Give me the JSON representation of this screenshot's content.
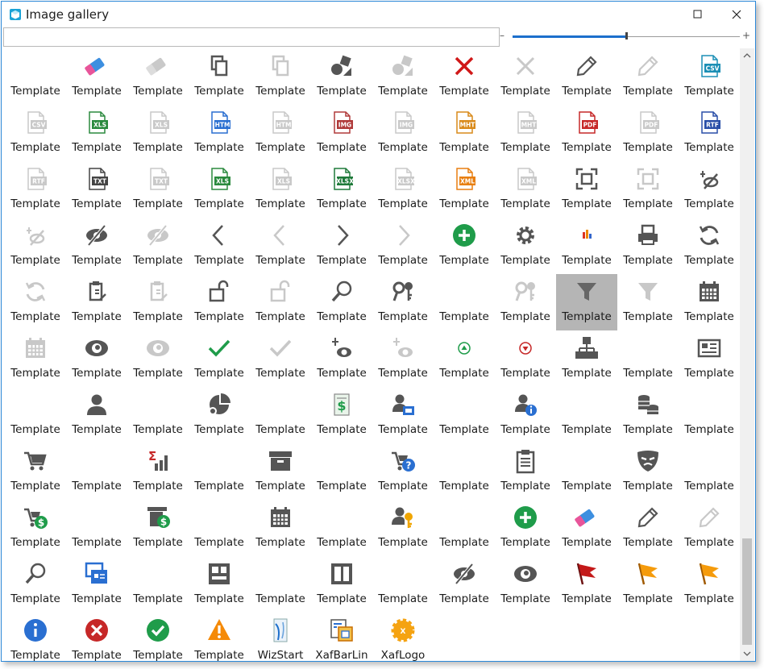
{
  "window": {
    "title": "Image gallery",
    "search": {
      "value": "",
      "placeholder": ""
    },
    "zoom": {
      "minus": "–",
      "plus": "+",
      "value": 0.5
    }
  },
  "colors": {
    "accent": "#1c6fcc",
    "selected": "#b5b5b5",
    "icon_gray": "#555555",
    "icon_disabled": "#c9c9c9"
  },
  "gallery": {
    "items": [
      {
        "label": "Template",
        "icon": "blank"
      },
      {
        "label": "Template",
        "icon": "eraser"
      },
      {
        "label": "Template",
        "icon": "eraser-disabled"
      },
      {
        "label": "Template",
        "icon": "copy"
      },
      {
        "label": "Template",
        "icon": "copy-disabled"
      },
      {
        "label": "Template",
        "icon": "shapes"
      },
      {
        "label": "Template",
        "icon": "shapes-disabled"
      },
      {
        "label": "Template",
        "icon": "delete-red-x"
      },
      {
        "label": "Template",
        "icon": "delete-x-disabled"
      },
      {
        "label": "Template",
        "icon": "pencil"
      },
      {
        "label": "Template",
        "icon": "pencil-disabled"
      },
      {
        "label": "Template",
        "icon": "csv-file"
      },
      {
        "label": "Template",
        "icon": "csv-disabled"
      },
      {
        "label": "Template",
        "icon": "xls-file"
      },
      {
        "label": "Template",
        "icon": "xls-disabled"
      },
      {
        "label": "Template",
        "icon": "htm-file"
      },
      {
        "label": "Template",
        "icon": "htm-disabled"
      },
      {
        "label": "Template",
        "icon": "img-file"
      },
      {
        "label": "Template",
        "icon": "img-disabled"
      },
      {
        "label": "Template",
        "icon": "mht-file"
      },
      {
        "label": "Template",
        "icon": "mht-disabled"
      },
      {
        "label": "Template",
        "icon": "pdf-file"
      },
      {
        "label": "Template",
        "icon": "pdf-disabled"
      },
      {
        "label": "Template",
        "icon": "rtf-file"
      },
      {
        "label": "Template",
        "icon": "rtf-disabled"
      },
      {
        "label": "Template",
        "icon": "txt-file"
      },
      {
        "label": "Template",
        "icon": "txt-disabled"
      },
      {
        "label": "Template",
        "icon": "xls-file"
      },
      {
        "label": "Template",
        "icon": "xls-disabled"
      },
      {
        "label": "Template",
        "icon": "xlsx-file"
      },
      {
        "label": "Template",
        "icon": "xlsx-disabled"
      },
      {
        "label": "Template",
        "icon": "xml-file"
      },
      {
        "label": "Template",
        "icon": "xml-disabled"
      },
      {
        "label": "Template",
        "icon": "fullscreen"
      },
      {
        "label": "Template",
        "icon": "fullscreen-disabled"
      },
      {
        "label": "Template",
        "icon": "hide-click"
      },
      {
        "label": "Template",
        "icon": "hide-click-disabled"
      },
      {
        "label": "Template",
        "icon": "eye-hidden"
      },
      {
        "label": "Template",
        "icon": "eye-hidden-disabled"
      },
      {
        "label": "Template",
        "icon": "chevron-left"
      },
      {
        "label": "Template",
        "icon": "chevron-left-disabled"
      },
      {
        "label": "Template",
        "icon": "chevron-right"
      },
      {
        "label": "Template",
        "icon": "chevron-right-disabled"
      },
      {
        "label": "Template",
        "icon": "add-green"
      },
      {
        "label": "Template",
        "icon": "gear"
      },
      {
        "label": "Template",
        "icon": "chart-small"
      },
      {
        "label": "Template",
        "icon": "printer"
      },
      {
        "label": "Template",
        "icon": "refresh"
      },
      {
        "label": "Template",
        "icon": "refresh-disabled"
      },
      {
        "label": "Template",
        "icon": "clipboard-edit"
      },
      {
        "label": "Template",
        "icon": "clipboard-edit-disabled"
      },
      {
        "label": "Template",
        "icon": "unlock"
      },
      {
        "label": "Template",
        "icon": "unlock-disabled"
      },
      {
        "label": "Template",
        "icon": "search"
      },
      {
        "label": "Template",
        "icon": "search-keys"
      },
      {
        "label": "Template",
        "icon": "blank"
      },
      {
        "label": "Template",
        "icon": "search-keys-disabled"
      },
      {
        "label": "Template",
        "icon": "filter",
        "selected": true
      },
      {
        "label": "Template",
        "icon": "filter-disabled"
      },
      {
        "label": "Template",
        "icon": "calendar"
      },
      {
        "label": "Template",
        "icon": "calendar-disabled"
      },
      {
        "label": "Template",
        "icon": "eye"
      },
      {
        "label": "Template",
        "icon": "eye-disabled"
      },
      {
        "label": "Template",
        "icon": "check"
      },
      {
        "label": "Template",
        "icon": "check-disabled"
      },
      {
        "label": "Template",
        "icon": "show-click"
      },
      {
        "label": "Template",
        "icon": "show-click-disabled"
      },
      {
        "label": "Template",
        "icon": "arrow-up-green"
      },
      {
        "label": "Template",
        "icon": "arrow-down-red"
      },
      {
        "label": "Template",
        "icon": "hierarchy"
      },
      {
        "label": "Template",
        "icon": "blank"
      },
      {
        "label": "Template",
        "icon": "business-card"
      },
      {
        "label": "Template",
        "icon": "blank"
      },
      {
        "label": "Template",
        "icon": "user"
      },
      {
        "label": "Template",
        "icon": "blank"
      },
      {
        "label": "Template",
        "icon": "pie-chart"
      },
      {
        "label": "Template",
        "icon": "blank"
      },
      {
        "label": "Template",
        "icon": "invoice"
      },
      {
        "label": "Template",
        "icon": "user-card"
      },
      {
        "label": "Template",
        "icon": "blank"
      },
      {
        "label": "Template",
        "icon": "user-info"
      },
      {
        "label": "Template",
        "icon": "blank"
      },
      {
        "label": "Template",
        "icon": "coins"
      },
      {
        "label": "Template",
        "icon": "blank"
      },
      {
        "label": "Template",
        "icon": "cart"
      },
      {
        "label": "Template",
        "icon": "blank"
      },
      {
        "label": "Template",
        "icon": "sum-chart"
      },
      {
        "label": "Template",
        "icon": "blank"
      },
      {
        "label": "Template",
        "icon": "archive"
      },
      {
        "label": "Template",
        "icon": "blank"
      },
      {
        "label": "Template",
        "icon": "cart-question"
      },
      {
        "label": "Template",
        "icon": "blank"
      },
      {
        "label": "Template",
        "icon": "clipboard"
      },
      {
        "label": "Template",
        "icon": "blank"
      },
      {
        "label": "Template",
        "icon": "mask"
      },
      {
        "label": "Template",
        "icon": "blank"
      },
      {
        "label": "Template",
        "icon": "cart-dollar"
      },
      {
        "label": "Template",
        "icon": "blank"
      },
      {
        "label": "Template",
        "icon": "cash-register"
      },
      {
        "label": "Template",
        "icon": "blank"
      },
      {
        "label": "Template",
        "icon": "calendar"
      },
      {
        "label": "Template",
        "icon": "blank"
      },
      {
        "label": "Template",
        "icon": "user-key"
      },
      {
        "label": "Template",
        "icon": "blank"
      },
      {
        "label": "Template",
        "icon": "add-green"
      },
      {
        "label": "Template",
        "icon": "eraser"
      },
      {
        "label": "Template",
        "icon": "pencil"
      },
      {
        "label": "Template",
        "icon": "pencil-disabled"
      },
      {
        "label": "Template",
        "icon": "search"
      },
      {
        "label": "Template",
        "icon": "window-card"
      },
      {
        "label": "Template",
        "icon": "blank"
      },
      {
        "label": "Template",
        "icon": "layout"
      },
      {
        "label": "Template",
        "icon": "blank"
      },
      {
        "label": "Template",
        "icon": "columns"
      },
      {
        "label": "Template",
        "icon": "blank"
      },
      {
        "label": "Template",
        "icon": "eye-hidden"
      },
      {
        "label": "Template",
        "icon": "eye"
      },
      {
        "label": "Template",
        "icon": "flag-red"
      },
      {
        "label": "Template",
        "icon": "flag-orange"
      },
      {
        "label": "Template",
        "icon": "flag-orange"
      },
      {
        "label": "Template",
        "icon": "info-blue"
      },
      {
        "label": "Template",
        "icon": "error-red"
      },
      {
        "label": "Template",
        "icon": "success-green"
      },
      {
        "label": "Template",
        "icon": "warning-orange"
      },
      {
        "label": "WizStart",
        "icon": "wizstart"
      },
      {
        "label": "XafBarLin",
        "icon": "xafbarlin"
      },
      {
        "label": "XafLogo",
        "icon": "xaflogo"
      }
    ]
  }
}
